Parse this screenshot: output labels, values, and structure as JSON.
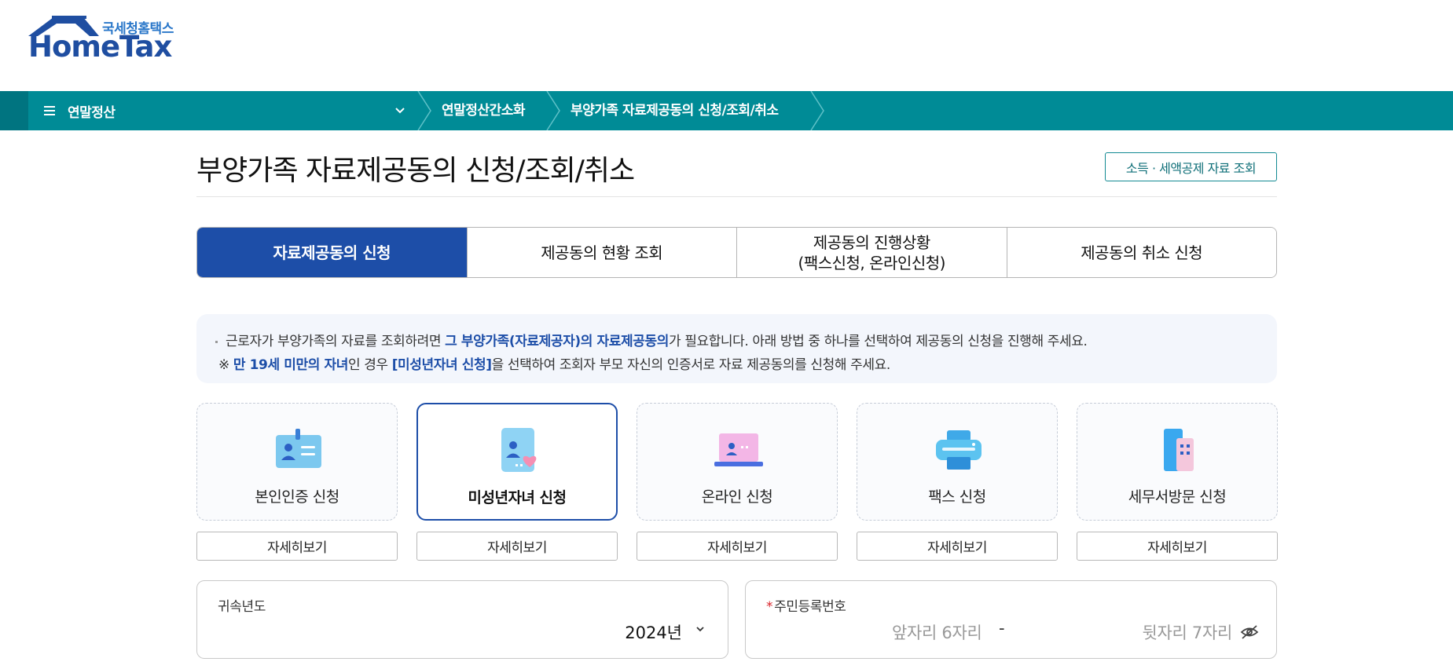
{
  "header": {
    "logo_korean": "국세청홈택스",
    "logo_english": "HomeTax"
  },
  "nav": {
    "menu_title": "연말정산",
    "breadcrumbs": [
      "연말정산간소화",
      "부양가족 자료제공동의 신청/조회/취소"
    ]
  },
  "page": {
    "title": "부양가족 자료제공동의 신청/조회/취소",
    "lookup_button": "소득 · 세액공제 자료 조회"
  },
  "tabs": [
    {
      "label": "자료제공동의 신청",
      "active": true
    },
    {
      "label": "제공동의 현황 조회",
      "active": false
    },
    {
      "label_line1": "제공동의 진행상황",
      "label_line2": "(팩스신청, 온라인신청)",
      "active": false
    },
    {
      "label": "제공동의 취소 신청",
      "active": false
    }
  ],
  "notice": {
    "line1_pre": "근로자가 부양가족의 자료를 조회하려면 ",
    "line1_hl": "그 부양가족(자료제공자)의 자료제공동의",
    "line1_post": "가 필요합니다. 아래 방법 중 하나를 선택하여 제공동의 신청을 진행해 주세요.",
    "line2_mark": "※ ",
    "line2_hl1": "만 19세 미만의 자녀",
    "line2_mid": "인 경우 ",
    "line2_hl2": "[미성년자녀 신청]",
    "line2_post": "을 선택하여 조회자 부모 자신의 인증서로 자료 제공동의를 신청해 주세요."
  },
  "methods": [
    {
      "label": "본인인증 신청",
      "icon": "id-card-icon",
      "detail": "자세히보기",
      "selected": false
    },
    {
      "label": "미성년자녀 신청",
      "icon": "child-heart-icon",
      "detail": "자세히보기",
      "selected": true
    },
    {
      "label": "온라인 신청",
      "icon": "laptop-icon",
      "detail": "자세히보기",
      "selected": false
    },
    {
      "label": "팩스 신청",
      "icon": "fax-icon",
      "detail": "자세히보기",
      "selected": false
    },
    {
      "label": "세무서방문 신청",
      "icon": "building-icon",
      "detail": "자세히보기",
      "selected": false
    }
  ],
  "form": {
    "year_label": "귀속년도",
    "year_value": "2024년",
    "ssn_label": "주민등록번호",
    "ssn_required_mark": "*",
    "ssn_front_placeholder": "앞자리 6자리",
    "ssn_separator": "-",
    "ssn_back_placeholder": "뒷자리 7자리"
  },
  "colors": {
    "teal": "#008b96",
    "navy": "#1d4ea8",
    "required": "#d9242b"
  }
}
